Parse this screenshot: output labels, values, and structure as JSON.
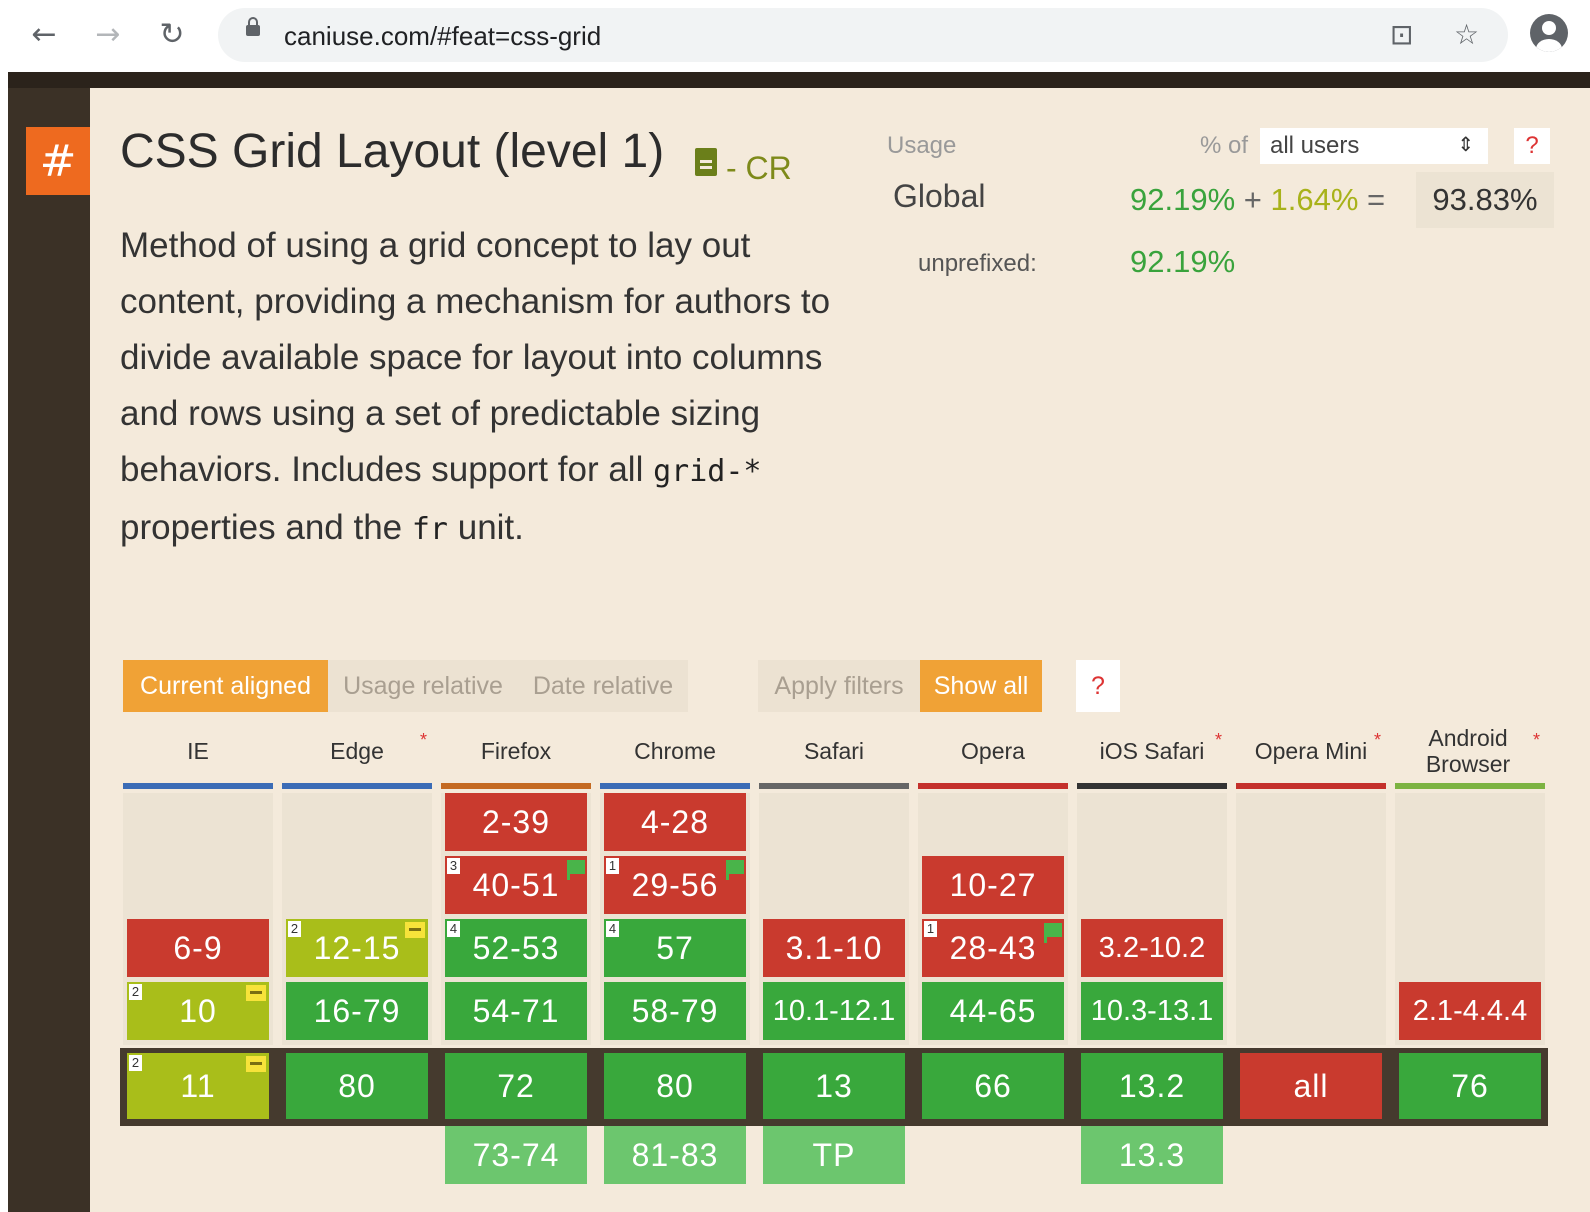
{
  "browser": {
    "url": "caniuse.com/#feat=css-grid",
    "icons": [
      "back-arrow-icon",
      "forward-arrow-icon",
      "reload-icon",
      "lock-icon",
      "translate-icon",
      "star-icon",
      "profile-icon"
    ]
  },
  "feature": {
    "anchor": "#",
    "title": "CSS Grid Layout (level 1)",
    "status": "- CR",
    "description_parts": [
      "Method of using a grid concept to lay out content, providing a mechanism for authors to divide available space for layout into columns and rows using a set of predictable sizing behaviors. Includes support for all ",
      "grid-*",
      " properties and the ",
      "fr",
      " unit."
    ]
  },
  "usage": {
    "label": "Usage",
    "pct_of": "% of",
    "users_option": "all users",
    "help": "?",
    "global_label": "Global",
    "supported": "92.19%",
    "plus": "+",
    "partial": "1.64%",
    "equals": "=",
    "total": "93.83%",
    "unprefixed_label": "unprefixed:",
    "unprefixed_value": "92.19%"
  },
  "toggles": {
    "current_aligned": "Current aligned",
    "usage_relative": "Usage relative",
    "date_relative": "Date relative",
    "apply_filters": "Apply filters",
    "show_all": "Show all",
    "help": "?"
  },
  "colors": {
    "supported": "#39a83c",
    "unsupported": "#c93a2e",
    "partial": "#a9be1a",
    "future": "#6cc66e",
    "accent": "#f0a236",
    "anchor": "#ee6a1f"
  },
  "browsers": [
    {
      "name": "IE",
      "line": "#3b6cb6",
      "asterisk": "",
      "rows": [
        {
          "slot": 2,
          "ver": "6-9",
          "st": "n",
          "note": "",
          "flag": false,
          "prefix": false
        },
        {
          "slot": 3,
          "ver": "10",
          "st": "a",
          "note": "2",
          "flag": false,
          "prefix": true
        },
        {
          "slot": 4,
          "ver": "11",
          "st": "a",
          "note": "2",
          "flag": false,
          "prefix": true
        }
      ]
    },
    {
      "name": "Edge",
      "line": "#3b6cb6",
      "asterisk": "*",
      "rows": [
        {
          "slot": 2,
          "ver": "12-15",
          "st": "a",
          "note": "2",
          "flag": false,
          "prefix": true
        },
        {
          "slot": 3,
          "ver": "16-79",
          "st": "y",
          "note": "",
          "flag": false,
          "prefix": false
        },
        {
          "slot": 4,
          "ver": "80",
          "st": "y",
          "note": "",
          "flag": false,
          "prefix": false
        }
      ]
    },
    {
      "name": "Firefox",
      "line": "#c46a22",
      "asterisk": "",
      "rows": [
        {
          "slot": 0,
          "ver": "2-39",
          "st": "n",
          "note": "",
          "flag": false,
          "prefix": false
        },
        {
          "slot": 1,
          "ver": "40-51",
          "st": "n",
          "note": "3",
          "flag": true,
          "prefix": false
        },
        {
          "slot": 2,
          "ver": "52-53",
          "st": "y",
          "note": "4",
          "flag": false,
          "prefix": false
        },
        {
          "slot": 3,
          "ver": "54-71",
          "st": "y",
          "note": "",
          "flag": false,
          "prefix": false
        },
        {
          "slot": 4,
          "ver": "72",
          "st": "y",
          "note": "",
          "flag": false,
          "prefix": false
        },
        {
          "slot": 5,
          "ver": "73-74",
          "st": "f",
          "note": "",
          "flag": false,
          "prefix": false
        }
      ]
    },
    {
      "name": "Chrome",
      "line": "#3b6cb6",
      "asterisk": "",
      "rows": [
        {
          "slot": 0,
          "ver": "4-28",
          "st": "n",
          "note": "",
          "flag": false,
          "prefix": false
        },
        {
          "slot": 1,
          "ver": "29-56",
          "st": "n",
          "note": "1",
          "flag": true,
          "prefix": false
        },
        {
          "slot": 2,
          "ver": "57",
          "st": "y",
          "note": "4",
          "flag": false,
          "prefix": false
        },
        {
          "slot": 3,
          "ver": "58-79",
          "st": "y",
          "note": "",
          "flag": false,
          "prefix": false
        },
        {
          "slot": 4,
          "ver": "80",
          "st": "y",
          "note": "",
          "flag": false,
          "prefix": false
        },
        {
          "slot": 5,
          "ver": "81-83",
          "st": "f",
          "note": "",
          "flag": false,
          "prefix": false
        }
      ]
    },
    {
      "name": "Safari",
      "line": "#666666",
      "asterisk": "",
      "rows": [
        {
          "slot": 2,
          "ver": "3.1-10",
          "st": "n",
          "note": "",
          "flag": false,
          "prefix": false
        },
        {
          "slot": 3,
          "ver": "10.1-12.1",
          "st": "y",
          "note": "",
          "flag": false,
          "prefix": false
        },
        {
          "slot": 4,
          "ver": "13",
          "st": "y",
          "note": "",
          "flag": false,
          "prefix": false
        },
        {
          "slot": 5,
          "ver": "TP",
          "st": "f",
          "note": "",
          "flag": false,
          "prefix": false
        }
      ]
    },
    {
      "name": "Opera",
      "line": "#c4302b",
      "asterisk": "",
      "rows": [
        {
          "slot": 1,
          "ver": "10-27",
          "st": "n",
          "note": "",
          "flag": false,
          "prefix": false
        },
        {
          "slot": 2,
          "ver": "28-43",
          "st": "n",
          "note": "1",
          "flag": true,
          "prefix": false
        },
        {
          "slot": 3,
          "ver": "44-65",
          "st": "y",
          "note": "",
          "flag": false,
          "prefix": false
        },
        {
          "slot": 4,
          "ver": "66",
          "st": "y",
          "note": "",
          "flag": false,
          "prefix": false
        }
      ]
    },
    {
      "name": "iOS Safari",
      "line": "#333333",
      "asterisk": "*",
      "rows": [
        {
          "slot": 2,
          "ver": "3.2-10.2",
          "st": "n",
          "note": "",
          "flag": false,
          "prefix": false
        },
        {
          "slot": 3,
          "ver": "10.3-13.1",
          "st": "y",
          "note": "",
          "flag": false,
          "prefix": false
        },
        {
          "slot": 4,
          "ver": "13.2",
          "st": "y",
          "note": "",
          "flag": false,
          "prefix": false
        },
        {
          "slot": 5,
          "ver": "13.3",
          "st": "f",
          "note": "",
          "flag": false,
          "prefix": false
        }
      ]
    },
    {
      "name": "Opera Mini",
      "line": "#c4302b",
      "asterisk": "*",
      "rows": [
        {
          "slot": 4,
          "ver": "all",
          "st": "n",
          "note": "",
          "flag": false,
          "prefix": false
        }
      ]
    },
    {
      "name": "Android Browser",
      "line": "#7cb342",
      "asterisk": "*",
      "rows": [
        {
          "slot": 3,
          "ver": "2.1-4.4.4",
          "st": "n",
          "note": "",
          "flag": false,
          "prefix": false
        },
        {
          "slot": 4,
          "ver": "76",
          "st": "y",
          "note": "",
          "flag": false,
          "prefix": false
        }
      ]
    }
  ]
}
